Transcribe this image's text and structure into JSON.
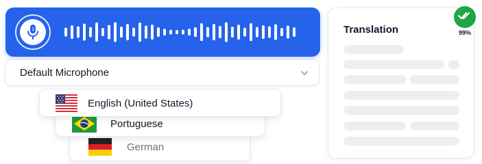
{
  "recorder": {
    "mic_icon": "microphone-icon",
    "wave_levels": [
      0.42,
      0.64,
      0.52,
      0.78,
      0.48,
      0.88,
      0.36,
      0.66,
      0.92,
      0.5,
      0.74,
      0.4,
      0.86,
      0.58,
      0.7,
      0.44,
      0.3,
      0.22,
      0.18,
      0.22,
      0.32,
      0.44,
      0.82,
      0.48,
      0.76,
      0.56,
      0.9,
      0.5,
      0.68,
      0.4,
      0.8,
      0.46,
      0.62,
      0.52,
      0.72,
      0.38,
      0.58,
      0.44
    ],
    "color": "#2563eb"
  },
  "device": {
    "label": "Default Microphone",
    "chevron_icon": "chevron-down-icon"
  },
  "languages": [
    {
      "label": "English (United States)",
      "flag": "us-flag-icon"
    },
    {
      "label": "Portuguese",
      "flag": "brazil-flag-icon"
    },
    {
      "label": "German",
      "flag": "germany-flag-icon"
    }
  ],
  "translation": {
    "title": "Translation",
    "confidence": "99%",
    "badge_icon": "double-check-icon",
    "badge_color": "#22a447"
  }
}
